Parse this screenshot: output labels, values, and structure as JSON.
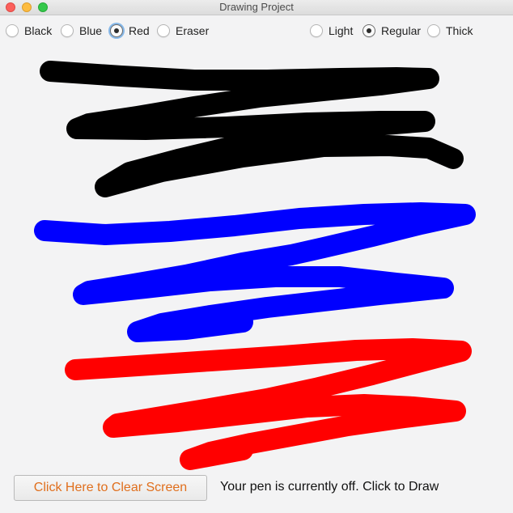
{
  "window": {
    "title": "Drawing Project"
  },
  "colors": {
    "selected": "Red",
    "options": [
      {
        "label": "Black",
        "checked": false
      },
      {
        "label": "Blue",
        "checked": false
      },
      {
        "label": "Red",
        "checked": true
      },
      {
        "label": "Eraser",
        "checked": false
      }
    ]
  },
  "thickness": {
    "selected": "Regular",
    "options": [
      {
        "label": "Light",
        "checked": false
      },
      {
        "label": "Regular",
        "checked": true
      },
      {
        "label": "Thick",
        "checked": false
      }
    ]
  },
  "canvas": {
    "stroke_colors": {
      "black": "#000000",
      "blue": "#0000ff",
      "red": "#ff0000"
    }
  },
  "footer": {
    "clear_button_label": "Click Here to Clear Screen",
    "status_text": "Your pen is currently off. Click to Draw",
    "clear_button_text_color": "#e06f1d"
  }
}
